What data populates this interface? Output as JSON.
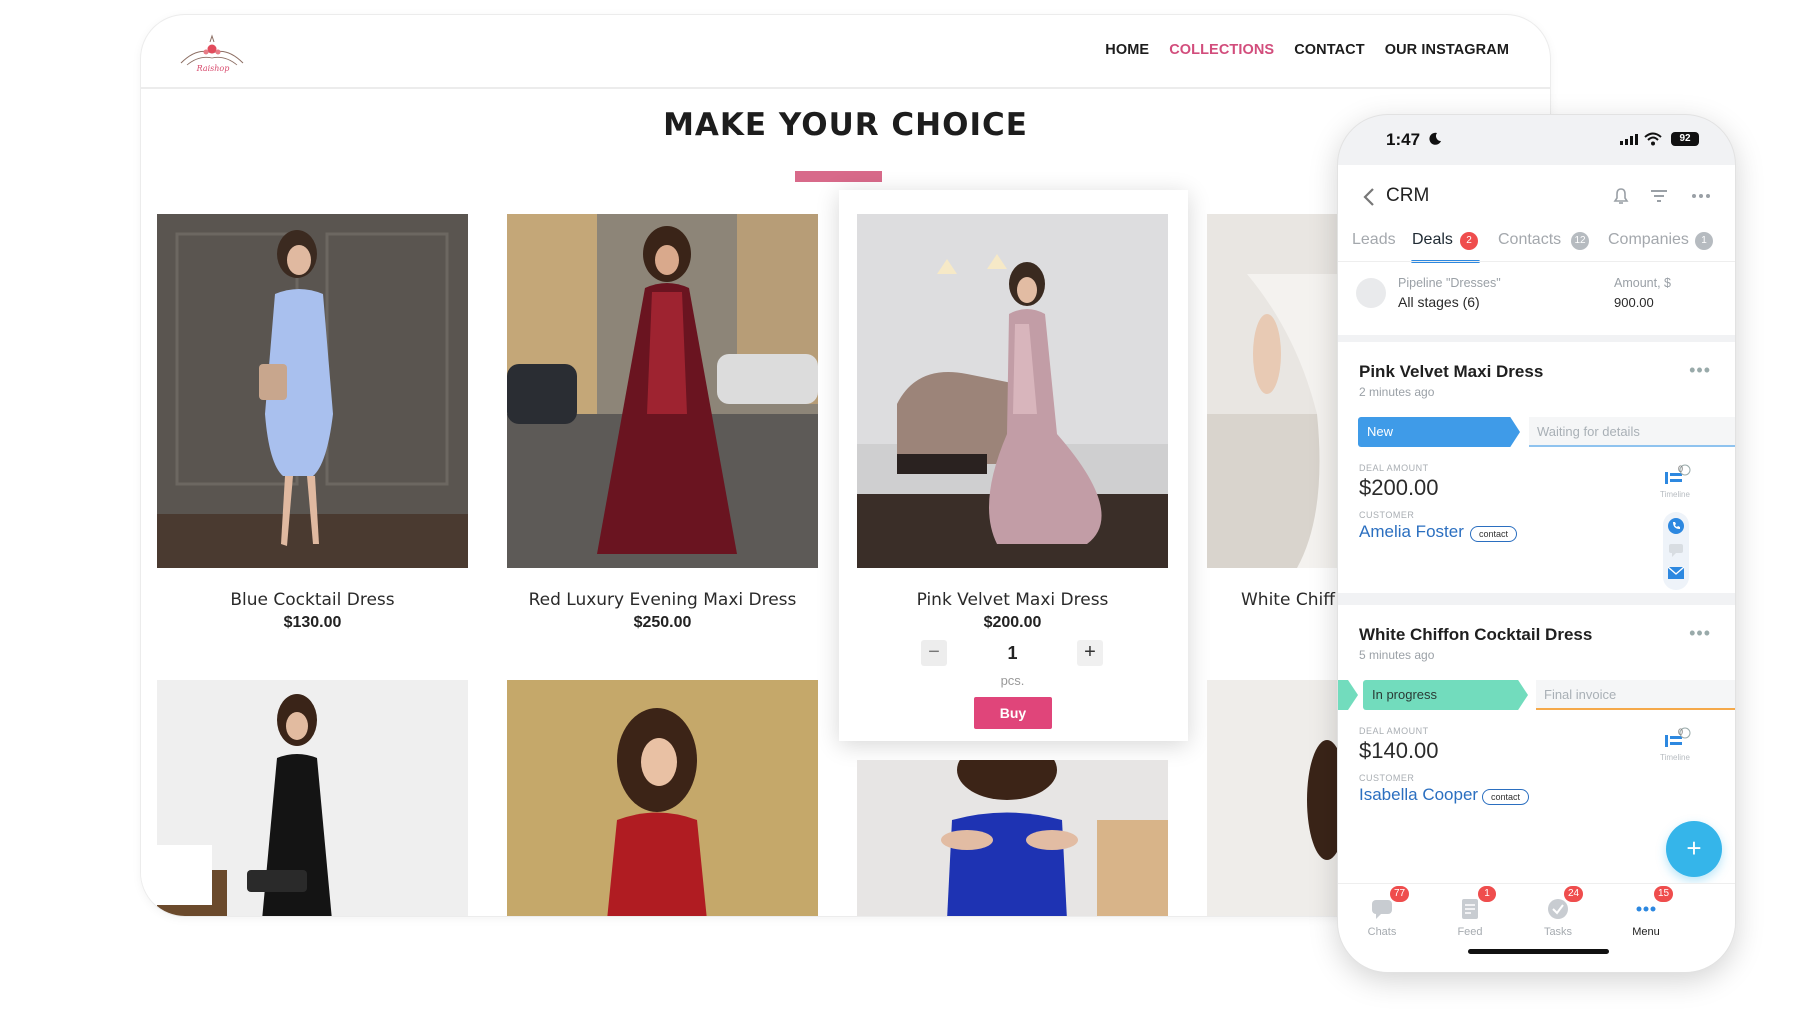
{
  "shop": {
    "logo_text": "Raishop",
    "nav": [
      "HOME",
      "COLLECTIONS",
      "CONTACT",
      "OUR INSTAGRAM"
    ],
    "active_nav": "COLLECTIONS",
    "title": "MAKE YOUR CHOICE",
    "accent_color": "#d24d7c",
    "products": [
      {
        "name": "Blue Cocktail Dress",
        "price": "$130.00"
      },
      {
        "name": "Red Luxury Evening Maxi Dress",
        "price": "$250.00"
      },
      {
        "name": "Pink Velvet Maxi Dress",
        "price": "$200.00"
      },
      {
        "name": "White Chiff",
        "price": ""
      }
    ],
    "selected": {
      "quantity": "1",
      "unit": "pcs.",
      "minus": "−",
      "plus": "+",
      "buy_label": "Buy"
    }
  },
  "phone": {
    "status": {
      "time": "1:47",
      "battery": "92"
    },
    "header": {
      "title": "CRM"
    },
    "tabs": [
      {
        "label": "Leads",
        "badge": ""
      },
      {
        "label": "Deals",
        "badge": "2"
      },
      {
        "label": "Contacts",
        "badge": "12"
      },
      {
        "label": "Companies",
        "badge": "1"
      }
    ],
    "pipeline": {
      "label": "Pipeline \"Dresses\"",
      "stage": "All stages (6)",
      "amount_label": "Amount, $",
      "amount_value": "900.00"
    },
    "deals": [
      {
        "title": "Pink Velvet Maxi Dress",
        "time": "2 minutes ago",
        "stage": "New",
        "next_stage": "Waiting for details",
        "amount_label": "DEAL AMOUNT",
        "amount": "$200.00",
        "customer_label": "CUSTOMER",
        "customer": "Amelia Foster",
        "tag": "contact",
        "timeline_label": "Timeline",
        "timeline_count": "0"
      },
      {
        "title": "White Chiffon Cocktail Dress",
        "time": "5 minutes ago",
        "stage": "In progress",
        "next_stage": "Final invoice",
        "amount_label": "DEAL AMOUNT",
        "amount": "$140.00",
        "customer_label": "CUSTOMER",
        "customer": "Isabella Cooper",
        "tag": "contact",
        "timeline_label": "Timeline",
        "timeline_count": "0"
      }
    ],
    "fab": "+",
    "tabbar": [
      {
        "label": "Chats",
        "badge": "77",
        "icon": "chat-icon"
      },
      {
        "label": "Feed",
        "badge": "1",
        "icon": "feed-icon"
      },
      {
        "label": "Tasks",
        "badge": "24",
        "icon": "tasks-icon"
      },
      {
        "label": "Menu",
        "badge": "15",
        "icon": "menu-dots-icon"
      }
    ],
    "colors": {
      "blue": "#2d88e0",
      "stage_new": "#3f9be8",
      "stage_progress": "#72dcbd",
      "badge": "#ef4d4d"
    }
  }
}
